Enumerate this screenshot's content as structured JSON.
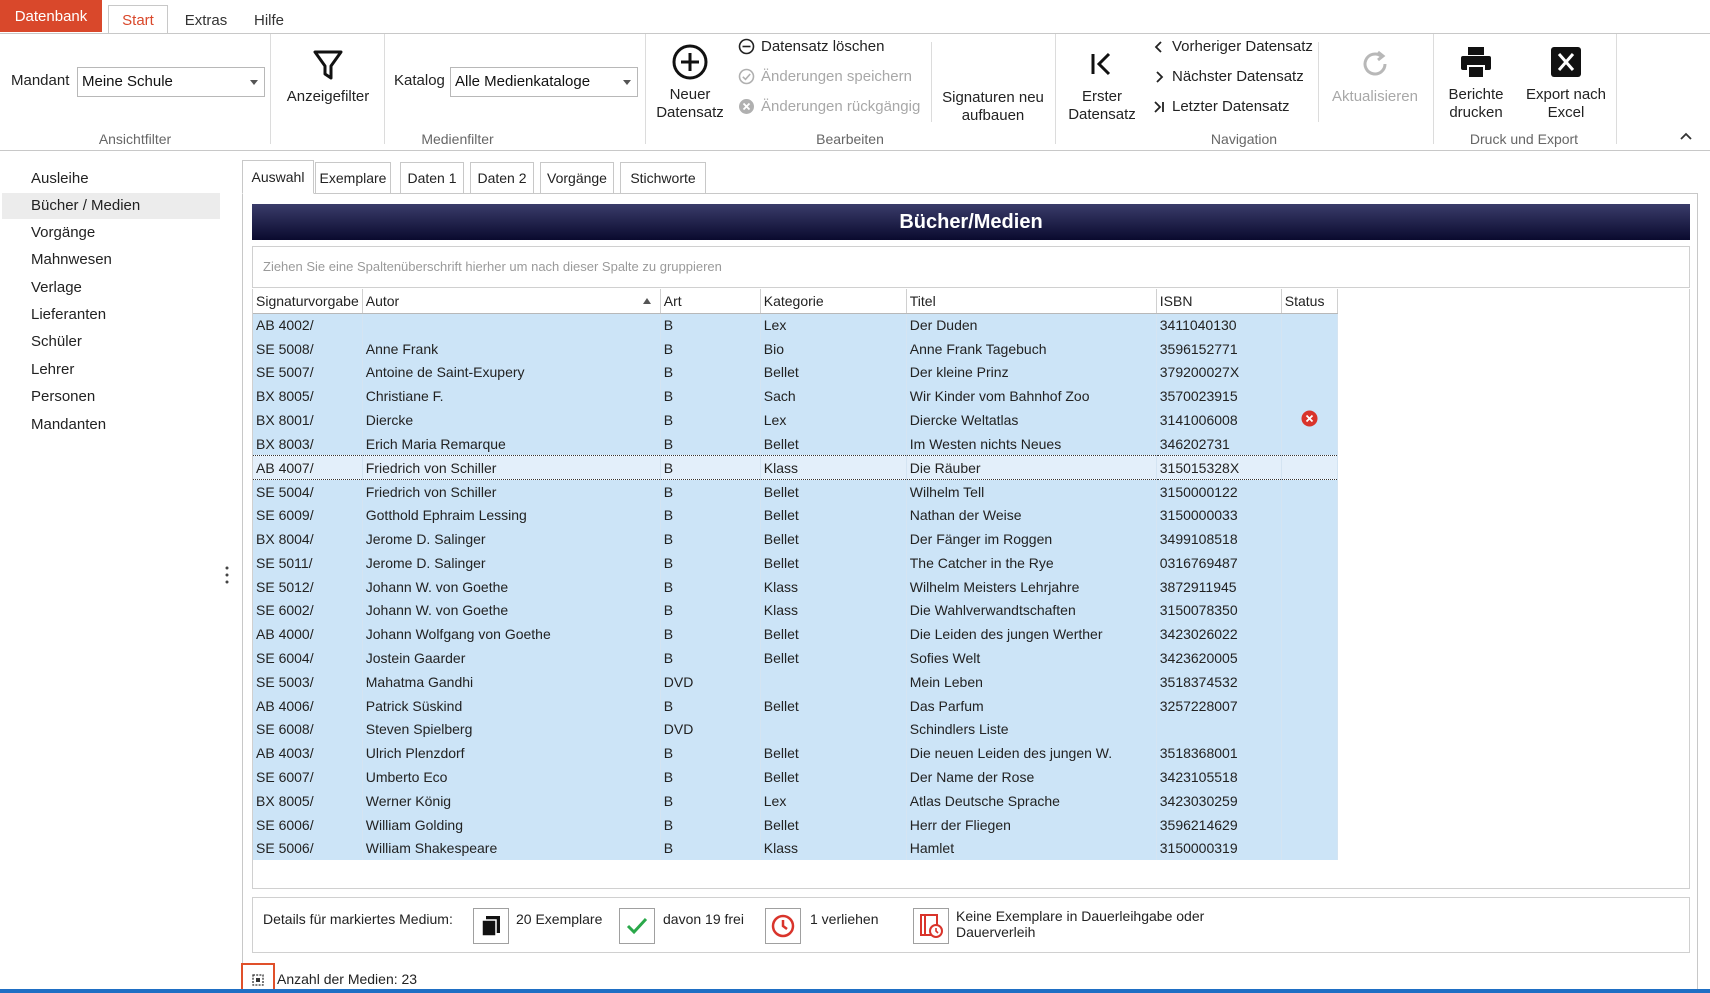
{
  "tabs": {
    "file": "Datenbank",
    "start": "Start",
    "extras": "Extras",
    "help": "Hilfe"
  },
  "ribbon": {
    "ansichtfilter": {
      "group": "Ansichtfilter",
      "mandant_label": "Mandant",
      "mandant_value": "Meine Schule"
    },
    "anzeigefilter": "Anzeigefilter",
    "medienfilter": {
      "group": "Medienfilter",
      "katalog_label": "Katalog",
      "katalog_value": "Alle Medienkataloge"
    },
    "bearbeiten": {
      "group": "Bearbeiten",
      "new": "Neuer Datensatz",
      "delete": "Datensatz löschen",
      "save": "Änderungen speichern",
      "undo": "Änderungen rückgängig",
      "signaturen": "Signaturen neu aufbauen"
    },
    "navigation": {
      "group": "Navigation",
      "first": "Erster Datensatz",
      "prev": "Vorheriger Datensatz",
      "next": "Nächster Datensatz",
      "last": "Letzter Datensatz",
      "refresh": "Aktualisieren"
    },
    "druck": {
      "group": "Druck und Export",
      "print": "Berichte drucken",
      "excel": "Export nach Excel"
    }
  },
  "sidebar": {
    "items": [
      "Ausleihe",
      "Bücher / Medien",
      "Vorgänge",
      "Mahnwesen",
      "Verlage",
      "Lieferanten",
      "Schüler",
      "Lehrer",
      "Personen",
      "Mandanten"
    ],
    "selected_index": 1
  },
  "content_tabs": [
    "Auswahl",
    "Exemplare",
    "Daten 1",
    "Daten 2",
    "Vorgänge",
    "Stichworte"
  ],
  "panel_title": "Bücher/Medien",
  "group_hint": "Ziehen Sie eine Spaltenüberschrift hierher um nach dieser Spalte zu gruppieren",
  "columns": [
    "Signaturvorgabe",
    "Autor",
    "Art",
    "Kategorie",
    "Titel",
    "ISBN",
    "Status"
  ],
  "rows": [
    [
      "AB 4002/",
      "",
      "B",
      "Lex",
      "Der Duden",
      "3411040130",
      ""
    ],
    [
      "SE 5008/",
      "Anne Frank",
      "B",
      "Bio",
      "Anne Frank Tagebuch",
      "3596152771",
      ""
    ],
    [
      "SE 5007/",
      "Antoine de Saint-Exupery",
      "B",
      "Bellet",
      "Der kleine Prinz",
      "379200027X",
      ""
    ],
    [
      "BX 8005/",
      "Christiane F.",
      "B",
      "Sach",
      "Wir Kinder vom Bahnhof Zoo",
      "3570023915",
      ""
    ],
    [
      "BX 8001/",
      "Diercke",
      "B",
      "Lex",
      "Diercke Weltatlas",
      "3141006008",
      "error"
    ],
    [
      "BX 8003/",
      "Erich Maria Remarque",
      "B",
      "Bellet",
      "Im Westen nichts Neues",
      "346202731",
      ""
    ],
    [
      "AB 4007/",
      "Friedrich von Schiller",
      "B",
      "Klass",
      "Die Räuber",
      "315015328X",
      ""
    ],
    [
      "SE 5004/",
      "Friedrich von Schiller",
      "B",
      "Bellet",
      "Wilhelm Tell",
      "3150000122",
      ""
    ],
    [
      "SE 6009/",
      "Gotthold Ephraim Lessing",
      "B",
      "Bellet",
      "Nathan der Weise",
      "3150000033",
      ""
    ],
    [
      "BX 8004/",
      "Jerome D. Salinger",
      "B",
      "Bellet",
      "Der Fänger im Roggen",
      "3499108518",
      ""
    ],
    [
      "SE 5011/",
      "Jerome D. Salinger",
      "B",
      "Bellet",
      "The Catcher in the Rye",
      "0316769487",
      ""
    ],
    [
      "SE 5012/",
      "Johann W. von Goethe",
      "B",
      "Klass",
      "Wilhelm Meisters Lehrjahre",
      "3872911945",
      ""
    ],
    [
      "SE 6002/",
      "Johann W. von Goethe",
      "B",
      "Klass",
      "Die Wahlverwandtschaften",
      "3150078350",
      ""
    ],
    [
      "AB 4000/",
      "Johann Wolfgang von Goethe",
      "B",
      "Bellet",
      "Die Leiden des jungen Werther",
      "3423026022",
      ""
    ],
    [
      "SE 6004/",
      "Jostein Gaarder",
      "B",
      "Bellet",
      "Sofies Welt",
      "3423620005",
      ""
    ],
    [
      "SE 5003/",
      "Mahatma Gandhi",
      "DVD",
      "",
      "Mein Leben",
      "3518374532",
      ""
    ],
    [
      "AB 4006/",
      "Patrick Süskind",
      "B",
      "Bellet",
      "Das Parfum",
      "3257228007",
      ""
    ],
    [
      "SE 6008/",
      "Steven Spielberg",
      "DVD",
      "",
      "Schindlers Liste",
      "",
      ""
    ],
    [
      "AB 4003/",
      "Ulrich Plenzdorf",
      "B",
      "Bellet",
      "Die neuen Leiden des jungen W.",
      "3518368001",
      ""
    ],
    [
      "SE 6007/",
      "Umberto Eco",
      "B",
      "Bellet",
      "Der Name der Rose",
      "3423105518",
      ""
    ],
    [
      "BX 8005/",
      "Werner König",
      "B",
      "Lex",
      "Atlas Deutsche Sprache",
      "3423030259",
      ""
    ],
    [
      "SE 6006/",
      "William Golding",
      "B",
      "Bellet",
      "Herr der Fliegen",
      "3596214629",
      ""
    ],
    [
      "SE 5006/",
      "William Shakespeare",
      "B",
      "Klass",
      "Hamlet",
      "3150000319",
      ""
    ]
  ],
  "focused_row": 6,
  "details": {
    "label": "Details für markiertes Medium:",
    "exemplare": "20 Exemplare",
    "frei": "davon 19 frei",
    "verliehen": "1 verliehen",
    "dauer_line1": "Keine Exemplare in Dauerleihgabe oder",
    "dauer_line2": "Dauerverleih"
  },
  "status": {
    "count": "Anzahl der Medien: 23"
  },
  "colors": {
    "accent": "#d9482b",
    "row": "#cce4f7",
    "header_dark": "#0a0a2e",
    "error": "#d9342b"
  }
}
